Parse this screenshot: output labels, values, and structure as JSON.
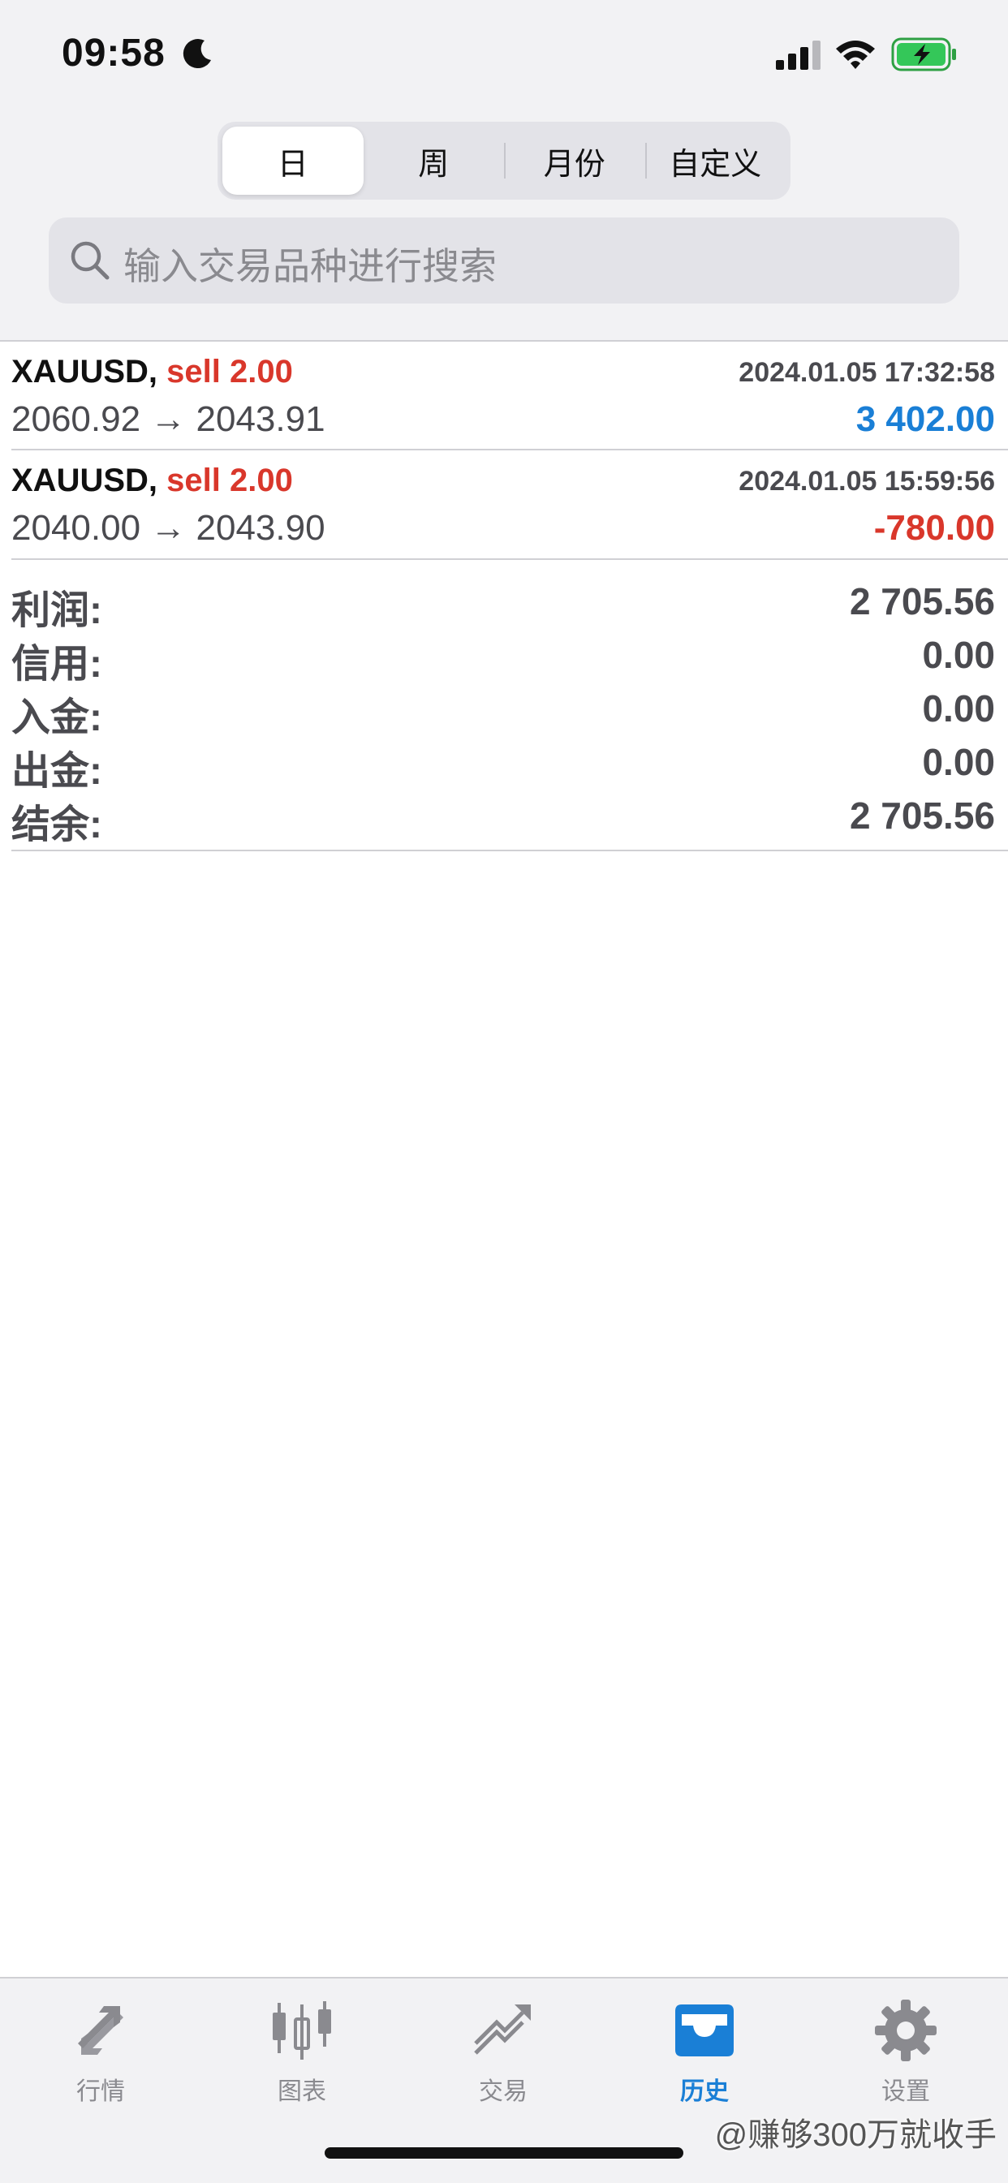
{
  "status_bar": {
    "time": "09:58"
  },
  "period_tabs": [
    {
      "label": "日",
      "active": true
    },
    {
      "label": "周",
      "active": false
    },
    {
      "label": "月份",
      "active": false
    },
    {
      "label": "自定义",
      "active": false
    }
  ],
  "search": {
    "placeholder": "输入交易品种进行搜索"
  },
  "deals": [
    {
      "symbol": "XAUUSD,",
      "type": "sell 2.00",
      "time": "2024.01.05 17:32:58",
      "prices": "2060.92 → 2043.91",
      "profit": "3 402.00",
      "profit_color": "#1a7fd6"
    },
    {
      "symbol": "XAUUSD,",
      "type": "sell 2.00",
      "time": "2024.01.05 15:59:56",
      "prices": "2040.00 → 2043.90",
      "profit": "-780.00",
      "profit_color": "#d9372b"
    }
  ],
  "summary": [
    {
      "label": "利润:",
      "value": "2 705.56"
    },
    {
      "label": "信用:",
      "value": "0.00"
    },
    {
      "label": "入金:",
      "value": "0.00"
    },
    {
      "label": "出金:",
      "value": "0.00"
    },
    {
      "label": "结余:",
      "value": "2 705.56"
    }
  ],
  "tabbar": [
    {
      "label": "行情",
      "icon": "quotes-arrows-icon",
      "active": false
    },
    {
      "label": "图表",
      "icon": "candlestick-chart-icon",
      "active": false
    },
    {
      "label": "交易",
      "icon": "trade-trend-icon",
      "active": false
    },
    {
      "label": "历史",
      "icon": "history-inbox-icon",
      "active": true
    },
    {
      "label": "设置",
      "icon": "gear-icon",
      "active": false
    }
  ],
  "watermark": "@赚够300万就收手",
  "colors": {
    "accent": "#1a7fd6",
    "sell": "#d9372b",
    "background": "#f2f2f4"
  }
}
